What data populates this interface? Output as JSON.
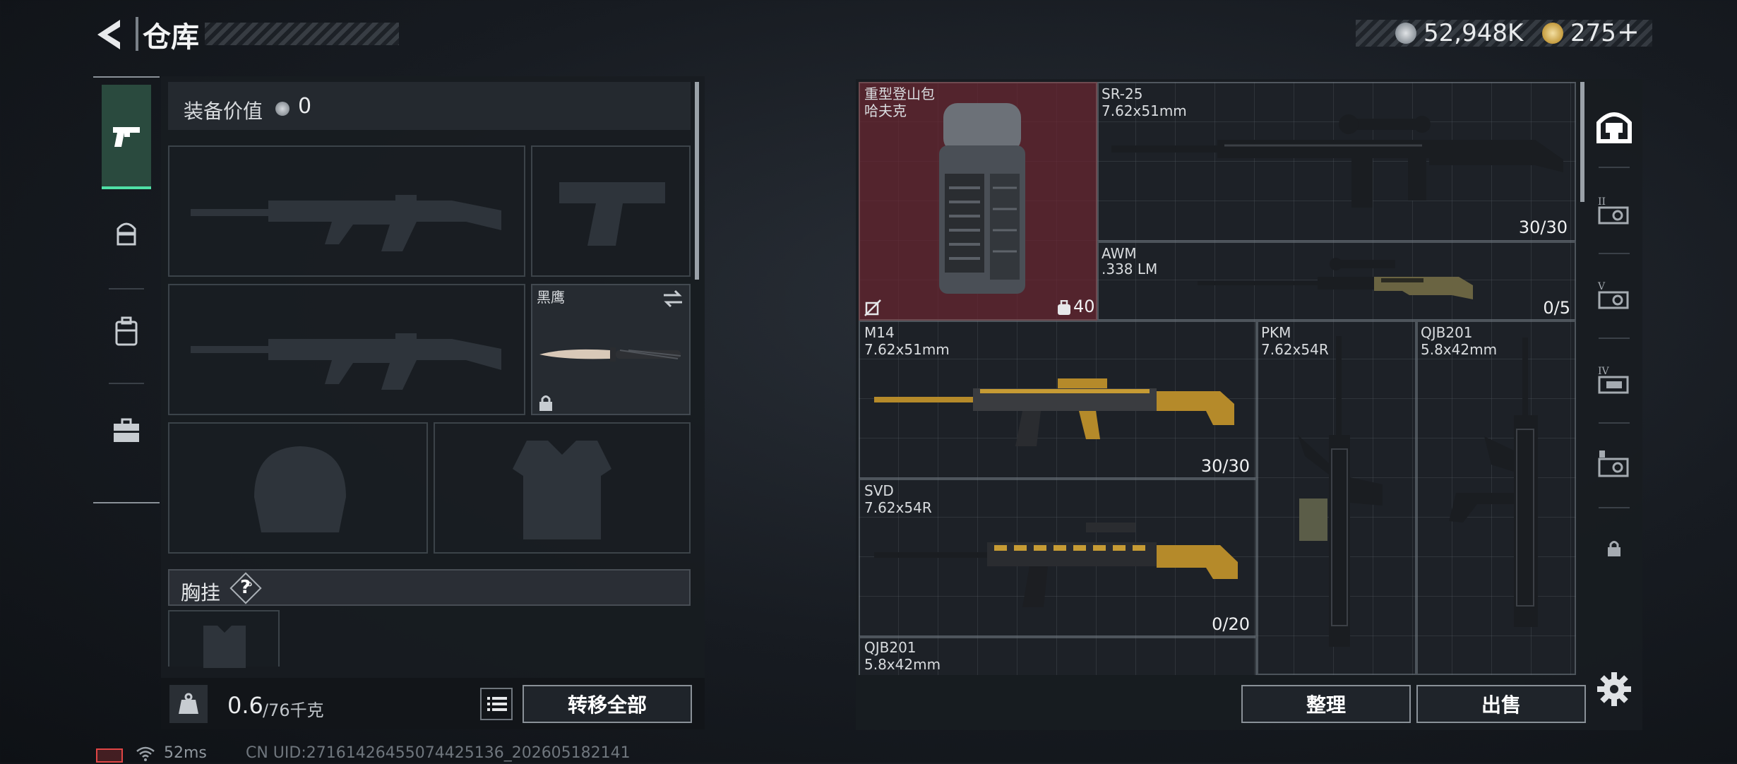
{
  "header": {
    "title": "仓库",
    "currency_silver": "52,948K",
    "currency_gold": "275",
    "currency_plus": "+"
  },
  "left_tabs": [
    {
      "icon": "pistol-icon",
      "active": true
    },
    {
      "icon": "helmet-vest-icon",
      "active": false
    },
    {
      "icon": "backpack-icon",
      "active": false
    },
    {
      "icon": "briefcase-icon",
      "active": false
    }
  ],
  "loadout": {
    "equip_value_label": "装备价值",
    "equip_value": "0",
    "knife_name": "黑鹰",
    "chest_rig_label": "胸挂",
    "chest_rig_help": "?",
    "weight_current": "0.6",
    "weight_max": "/76千克",
    "transfer_all_label": "转移全部"
  },
  "storage": {
    "items": [
      {
        "name": "重型登山包",
        "sub": "哈夫克",
        "count": "40"
      },
      {
        "name": "SR-25",
        "sub": "7.62x51mm",
        "ammo": "30/30"
      },
      {
        "name": "AWM",
        "sub": ".338 LM",
        "ammo": "0/5"
      },
      {
        "name": "M14",
        "sub": "7.62x51mm",
        "ammo": "30/30"
      },
      {
        "name": "PKM",
        "sub": "7.62x54R"
      },
      {
        "name": "QJB201",
        "sub": "5.8x42mm"
      },
      {
        "name": "SVD",
        "sub": "7.62x54R",
        "ammo": "0/20"
      },
      {
        "name": "QJB201",
        "sub": "5.8x42mm"
      }
    ],
    "sort_label": "整理",
    "sell_label": "出售"
  },
  "right_tabs": [
    {
      "icon": "safehouse-icon",
      "roman": ""
    },
    {
      "icon": "stash-ii-icon",
      "roman": "II"
    },
    {
      "icon": "stash-v-icon",
      "roman": "V"
    },
    {
      "icon": "stash-iv-icon",
      "roman": "IV"
    },
    {
      "icon": "stash-case-icon",
      "roman": ""
    },
    {
      "icon": "lock-icon",
      "roman": ""
    }
  ],
  "status_bar": {
    "ping": "52ms",
    "uid": "CN UID:271614264550744251​36_202605182141"
  }
}
